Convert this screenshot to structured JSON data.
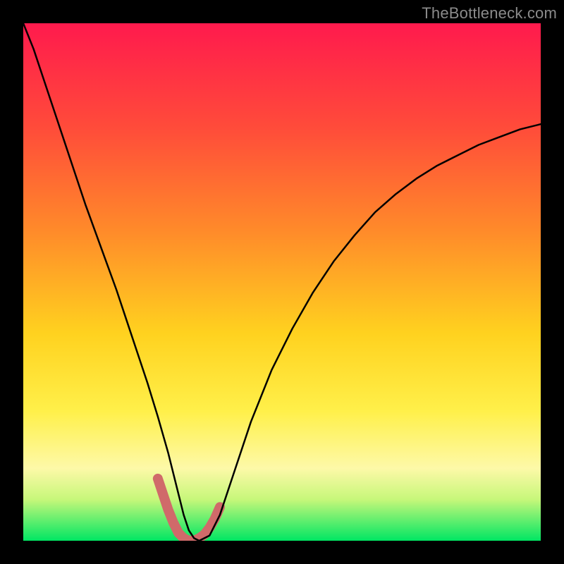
{
  "watermark": {
    "text": "TheBottleneck.com"
  },
  "chart_data": {
    "type": "line",
    "title": "",
    "xlabel": "",
    "ylabel": "",
    "xlim": [
      0,
      100
    ],
    "ylim": [
      0,
      100
    ],
    "grid": false,
    "legend": false,
    "gradient_stops": [
      {
        "pct": 0,
        "color": "#ff1a4d"
      },
      {
        "pct": 20,
        "color": "#ff4b3a"
      },
      {
        "pct": 40,
        "color": "#ff8a2a"
      },
      {
        "pct": 60,
        "color": "#ffd21f"
      },
      {
        "pct": 75,
        "color": "#fff04a"
      },
      {
        "pct": 86,
        "color": "#fdf9a8"
      },
      {
        "pct": 92,
        "color": "#c7f77a"
      },
      {
        "pct": 100,
        "color": "#00e663"
      }
    ],
    "series": [
      {
        "name": "curve",
        "color": "#000000",
        "stroke_width": 2.5,
        "x": [
          0,
          2,
          4,
          6,
          8,
          10,
          12,
          14,
          16,
          18,
          20,
          22,
          24,
          26,
          28,
          29,
          30,
          31,
          32,
          33,
          34,
          36,
          38,
          40,
          44,
          48,
          52,
          56,
          60,
          64,
          68,
          72,
          76,
          80,
          84,
          88,
          92,
          96,
          100
        ],
        "y": [
          100,
          95,
          89,
          83,
          77,
          71,
          65,
          59.5,
          54,
          48.5,
          42.5,
          36.5,
          30.5,
          24,
          17,
          13,
          9,
          5,
          2,
          0.5,
          0,
          1,
          5,
          11,
          23,
          33,
          41,
          48,
          54,
          59,
          63.5,
          67,
          70,
          72.5,
          74.5,
          76.5,
          78,
          79.5,
          80.5
        ]
      },
      {
        "name": "highlight",
        "color": "#d06a6a",
        "stroke_width": 14,
        "x": [
          26,
          27,
          28,
          29,
          30,
          31,
          32,
          33,
          34,
          35,
          36,
          37,
          38
        ],
        "y": [
          12,
          9,
          6,
          3.5,
          1.5,
          0.5,
          0,
          0,
          0.5,
          1.2,
          2.5,
          4.2,
          6.5
        ]
      }
    ],
    "axes_visible": false
  }
}
